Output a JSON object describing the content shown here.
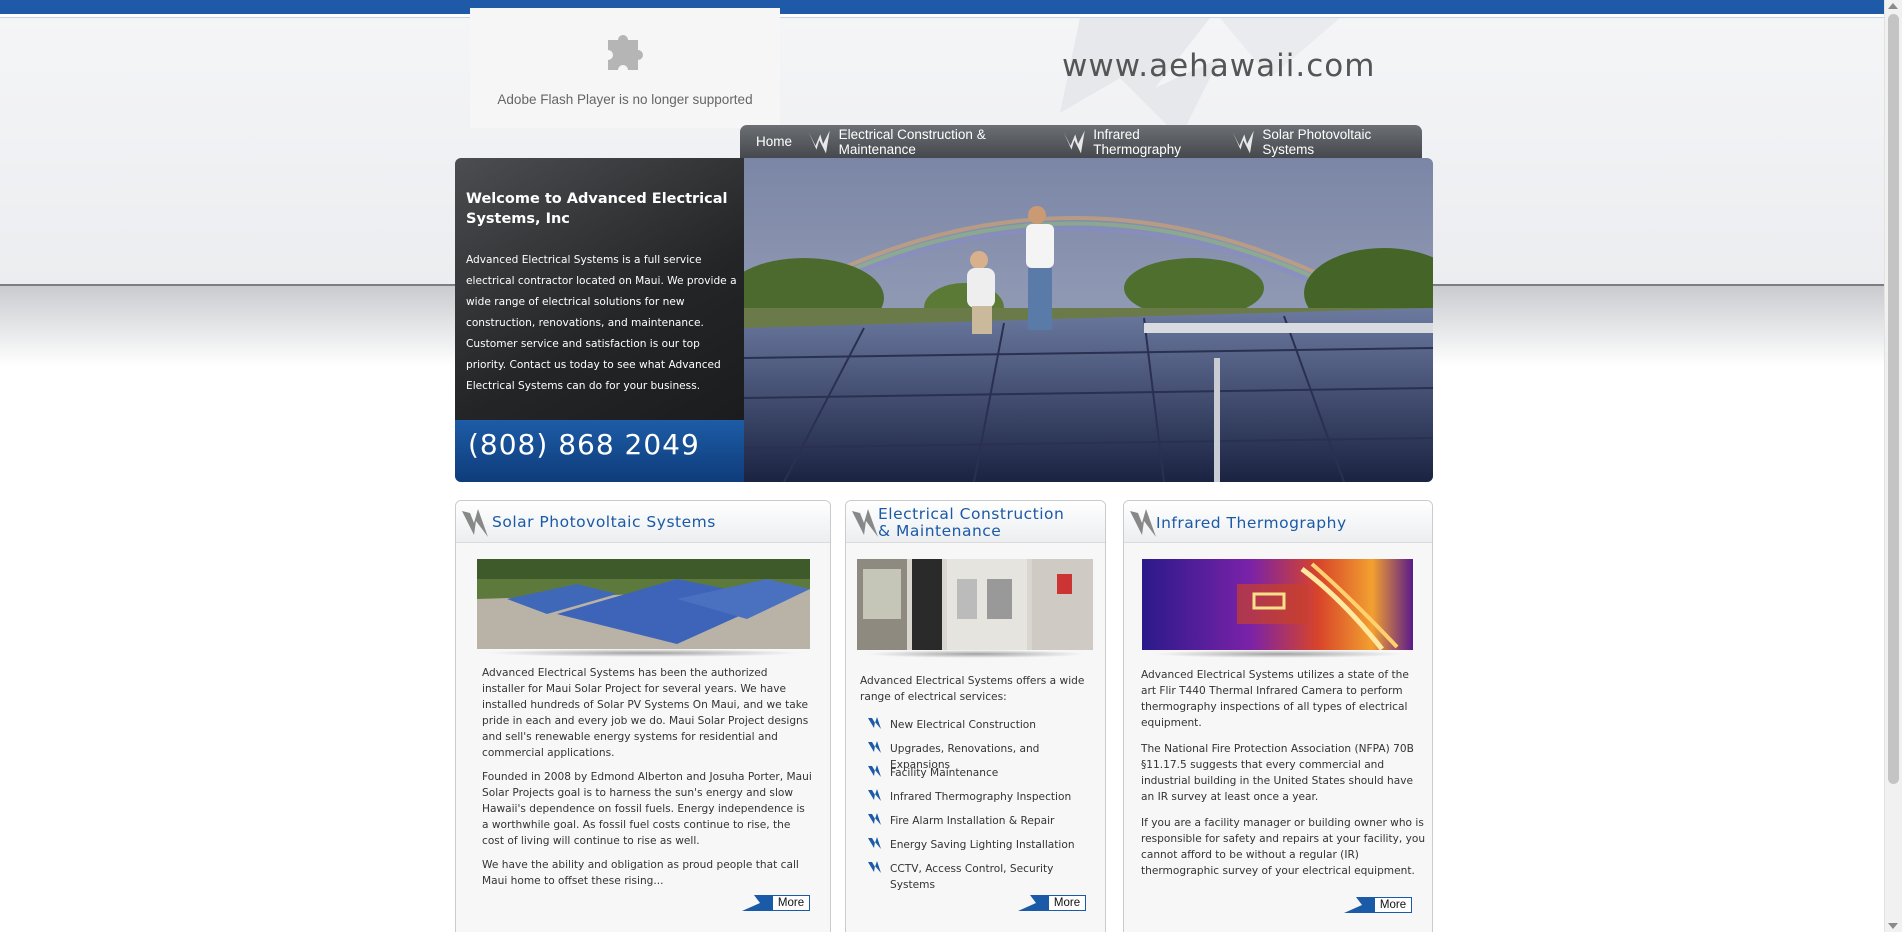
{
  "flash": {
    "message": "Adobe Flash Player is no longer supported"
  },
  "site": {
    "url_text": "www.aehawaii.com"
  },
  "nav": {
    "items": [
      "Home",
      "Electrical Construction & Maintenance",
      "Infrared Thermography",
      "Solar Photovoltaic Systems"
    ]
  },
  "hero": {
    "title": "Welcome to Advanced Electrical Systems, Inc",
    "text": "Advanced Electrical Systems is a full service electrical contractor located on Maui. We provide a wide range of electrical solutions for new construction, renovations, and maintenance. Customer service and satisfaction is our top priority. Contact us today to see what Advanced Electrical Systems can do for your business.",
    "phone": "(808) 868 2049"
  },
  "columns": {
    "solar": {
      "title": "Solar Photovoltaic Systems",
      "p1": "Advanced Electrical Systems has been the authorized installer for Maui Solar Project for several years. We have installed hundreds of Solar PV Systems On Maui, and we take pride in each and every job we do. Maui Solar Project designs and sell's renewable energy systems for residential and commercial applications.",
      "p2": "Founded in 2008 by Edmond Alberton and Josuha Porter, Maui Solar Projects goal is to harness the sun's energy and slow Hawaii's dependence on fossil fuels. Energy independence is a worthwhile goal. As fossil fuel costs continue to rise, the cost of living will continue to rise as well.",
      "p3": "We have the ability and obligation as proud people that call Maui home to offset these rising...",
      "more": "More"
    },
    "electrical": {
      "title_line1": "Electrical Construction",
      "title_line2": "& Maintenance",
      "intro": "Advanced Electrical Systems offers a wide range of electrical services:",
      "services": [
        "New Electrical Construction",
        "Upgrades, Renovations, and Expansions",
        "Facility Maintenance",
        "Infrared Thermography Inspection",
        "Fire Alarm Installation & Repair",
        "Energy Saving Lighting Installation",
        "CCTV, Access Control, Security Systems"
      ],
      "more": "More"
    },
    "infrared": {
      "title": "Infrared Thermography",
      "p1": "Advanced Electrical Systems utilizes a state of the art Flir T440 Thermal Infrared Camera to perform thermography inspections of all types of electrical equipment.",
      "p2": "The National Fire Protection Association (NFPA) 70B §11.17.5 suggests that every commercial and industrial building in the United States should have an IR survey at least once a year.",
      "p3": "If you are a facility manager or building owner who is responsible for safety and repairs at your facility, you cannot afford to be without a regular (IR) thermographic survey of your electrical equipment.",
      "more": "More"
    }
  },
  "colors": {
    "brand_blue": "#1b5aa7",
    "nav_gray": "#55585c"
  }
}
